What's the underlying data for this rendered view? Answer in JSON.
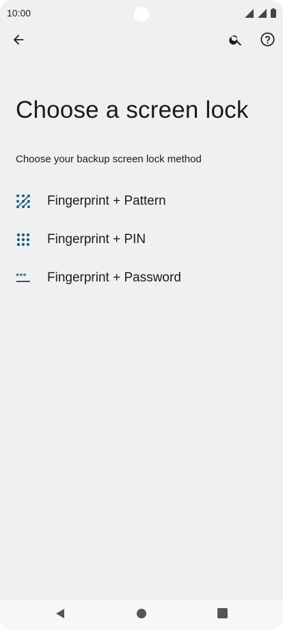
{
  "status_bar": {
    "time": "10:00",
    "icons": [
      "wifi-signal-icon",
      "cell-signal-icon",
      "battery-icon"
    ]
  },
  "app_bar": {
    "icons": [
      "back-arrow-icon",
      "search-icon",
      "help-icon"
    ]
  },
  "page": {
    "title": "Choose a screen lock",
    "subtitle": "Choose your backup screen lock method"
  },
  "options": [
    {
      "label": "Fingerprint + Pattern",
      "icon": "pattern-icon"
    },
    {
      "label": "Fingerprint + PIN",
      "icon": "pin-icon"
    },
    {
      "label": "Fingerprint + Password",
      "icon": "password-icon"
    }
  ],
  "nav_bar": {
    "icons": [
      "nav-back-icon",
      "nav-home-icon",
      "nav-recents-icon"
    ]
  },
  "colors": {
    "background": "#f0f0f3",
    "accent_icon": "#1f5f7a",
    "text": "#1b1b1f"
  }
}
